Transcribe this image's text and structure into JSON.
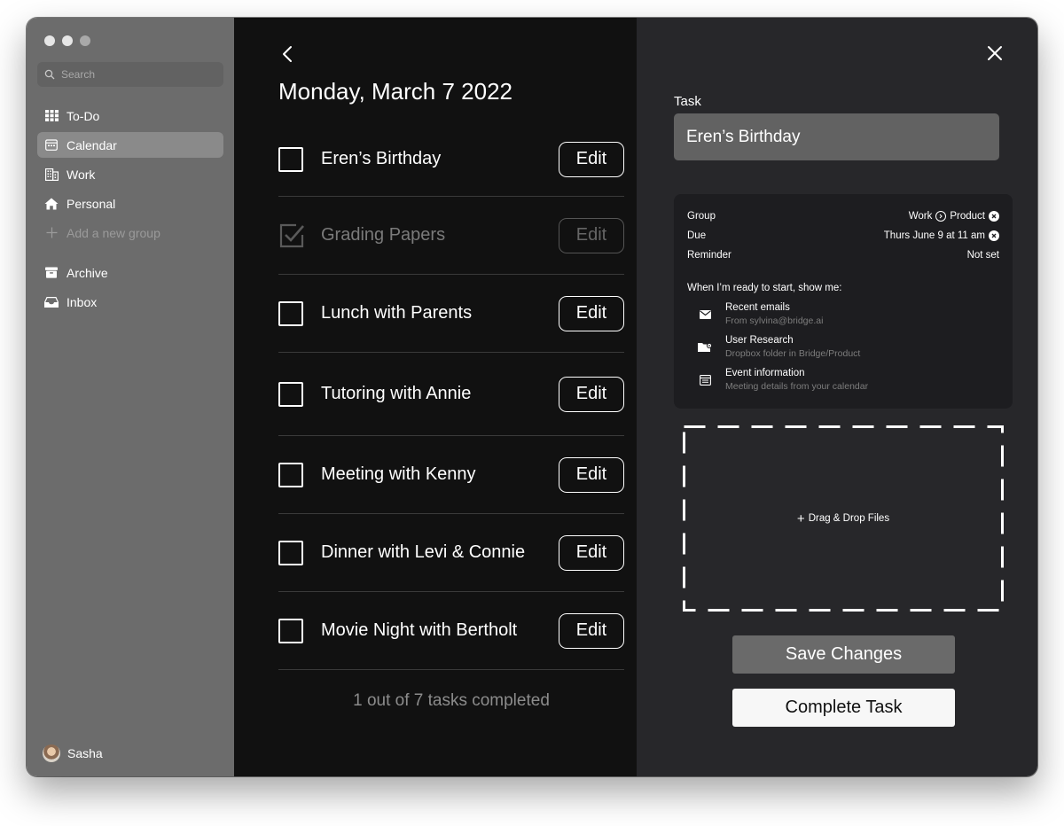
{
  "sidebar": {
    "search_placeholder": "Search",
    "items": [
      {
        "label": "To-Do",
        "icon": "grid-icon"
      },
      {
        "label": "Calendar",
        "icon": "calendar-icon",
        "active": true
      },
      {
        "label": "Work",
        "icon": "building-icon"
      },
      {
        "label": "Personal",
        "icon": "home-icon"
      }
    ],
    "add_group_label": "Add a new group",
    "secondary": [
      {
        "label": "Archive",
        "icon": "archive-icon"
      },
      {
        "label": "Inbox",
        "icon": "inbox-icon"
      }
    ],
    "user_name": "Sasha"
  },
  "main": {
    "date_title": "Monday, March 7 2022",
    "edit_label": "Edit",
    "tasks": [
      {
        "name": "Eren’s Birthday",
        "done": false
      },
      {
        "name": "Grading Papers",
        "done": true
      },
      {
        "name": "Lunch with Parents",
        "done": false
      },
      {
        "name": "Tutoring with Annie",
        "done": false
      },
      {
        "name": "Meeting with Kenny",
        "done": false
      },
      {
        "name": "Dinner with Levi & Connie",
        "done": false
      },
      {
        "name": "Movie Night with Bertholt",
        "done": false
      }
    ],
    "summary": "1 out of 7 tasks completed"
  },
  "detail": {
    "task_label": "Task",
    "task_value": "Eren’s Birthday",
    "group_label": "Group",
    "group_value": "Work",
    "group_sub": "Product",
    "due_label": "Due",
    "due_value": "Thurs June 9 at 11 am",
    "reminder_label": "Reminder",
    "reminder_value": "Not set",
    "show_me": "When I’m ready to start, show me:",
    "resources": [
      {
        "title": "Recent emails",
        "subtitle": "From sylvina@bridge.ai",
        "icon": "mail-icon"
      },
      {
        "title": "User Research",
        "subtitle": "Dropbox folder in Bridge/Product",
        "icon": "folder-icon"
      },
      {
        "title": "Event information",
        "subtitle": "Meeting details from your calendar",
        "icon": "calendar-icon"
      }
    ],
    "drop_label": "Drag & Drop Files",
    "save_label": "Save Changes",
    "complete_label": "Complete Task"
  },
  "colors": {
    "sidebar_bg": "#6c6c6c",
    "list_bg": "#111111",
    "panel_bg": "#27272a",
    "card_bg": "#1d1d20"
  }
}
